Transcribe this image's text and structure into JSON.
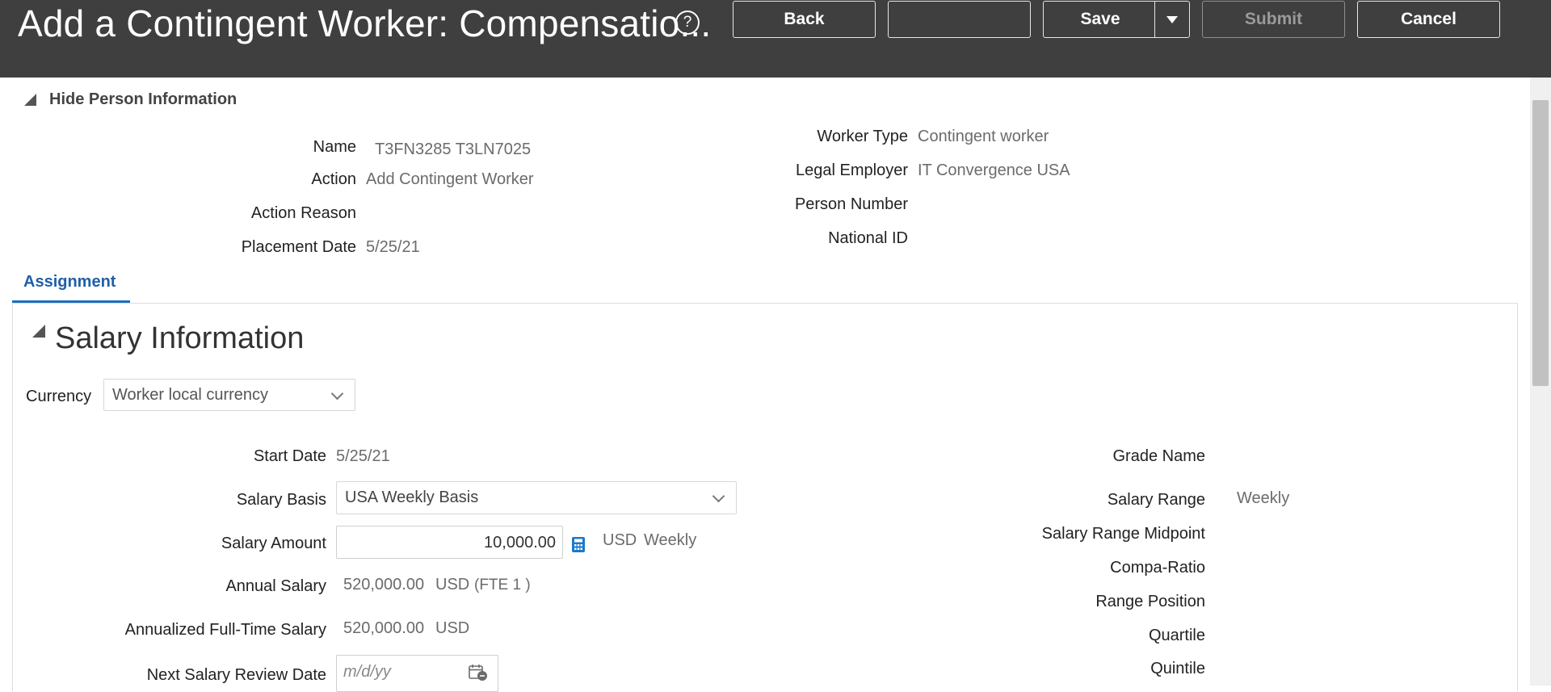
{
  "header": {
    "title": "Add a Contingent Worker: Compensatio...",
    "help_icon": "?",
    "buttons": {
      "back": "Back",
      "blank": "",
      "save": "Save",
      "submit": "Submit",
      "cancel": "Cancel"
    }
  },
  "person": {
    "toggle_label": "Hide Person Information",
    "left": [
      {
        "label": "Name",
        "value": "T3FN3285 T3LN7025"
      },
      {
        "label": "Action",
        "value": "Add Contingent Worker"
      },
      {
        "label": "Action Reason",
        "value": ""
      },
      {
        "label": "Placement Date",
        "value": "5/25/21"
      }
    ],
    "right": [
      {
        "label": "Worker Type",
        "value": "Contingent worker"
      },
      {
        "label": "Legal Employer",
        "value": "IT Convergence USA"
      },
      {
        "label": "Person Number",
        "value": ""
      },
      {
        "label": "National ID",
        "value": ""
      }
    ]
  },
  "tabs": [
    {
      "label": "Assignment",
      "selected": true
    }
  ],
  "salary": {
    "section_title": "Salary Information",
    "currency_label": "Currency",
    "currency_value": "Worker local currency",
    "start_date_label": "Start Date",
    "start_date_value": "5/25/21",
    "salary_basis_label": "Salary Basis",
    "salary_basis_value": "USA Weekly Basis",
    "salary_amount_label": "Salary Amount",
    "salary_amount_value": "10,000.00",
    "salary_amount_currency": "USD",
    "salary_amount_frequency": "Weekly",
    "annual_salary_label": "Annual Salary",
    "annual_salary_value": "520,000.00",
    "annual_salary_currency": "USD",
    "annual_salary_fte": "(FTE 1 )",
    "annualized_label": "Annualized Full-Time Salary",
    "annualized_value": "520,000.00",
    "annualized_currency": "USD",
    "next_review_label": "Next Salary Review Date",
    "next_review_placeholder": "m/d/yy",
    "right": {
      "grade_name_label": "Grade Name",
      "salary_range_label": "Salary Range",
      "salary_range_value": "Weekly",
      "midpoint_label": "Salary Range Midpoint",
      "compa_ratio_label": "Compa-Ratio",
      "range_position_label": "Range Position",
      "quartile_label": "Quartile",
      "quintile_label": "Quintile"
    }
  },
  "colors": {
    "header_bg": "#3f3f3f",
    "tab_accent": "#1f6fc1",
    "calculator_icon": "#1f78c8"
  },
  "icons": [
    "help-icon",
    "save-dropdown-icon",
    "collapse-triangle-icon",
    "chevron-down-icon",
    "calculator-icon",
    "calendar-icon"
  ]
}
